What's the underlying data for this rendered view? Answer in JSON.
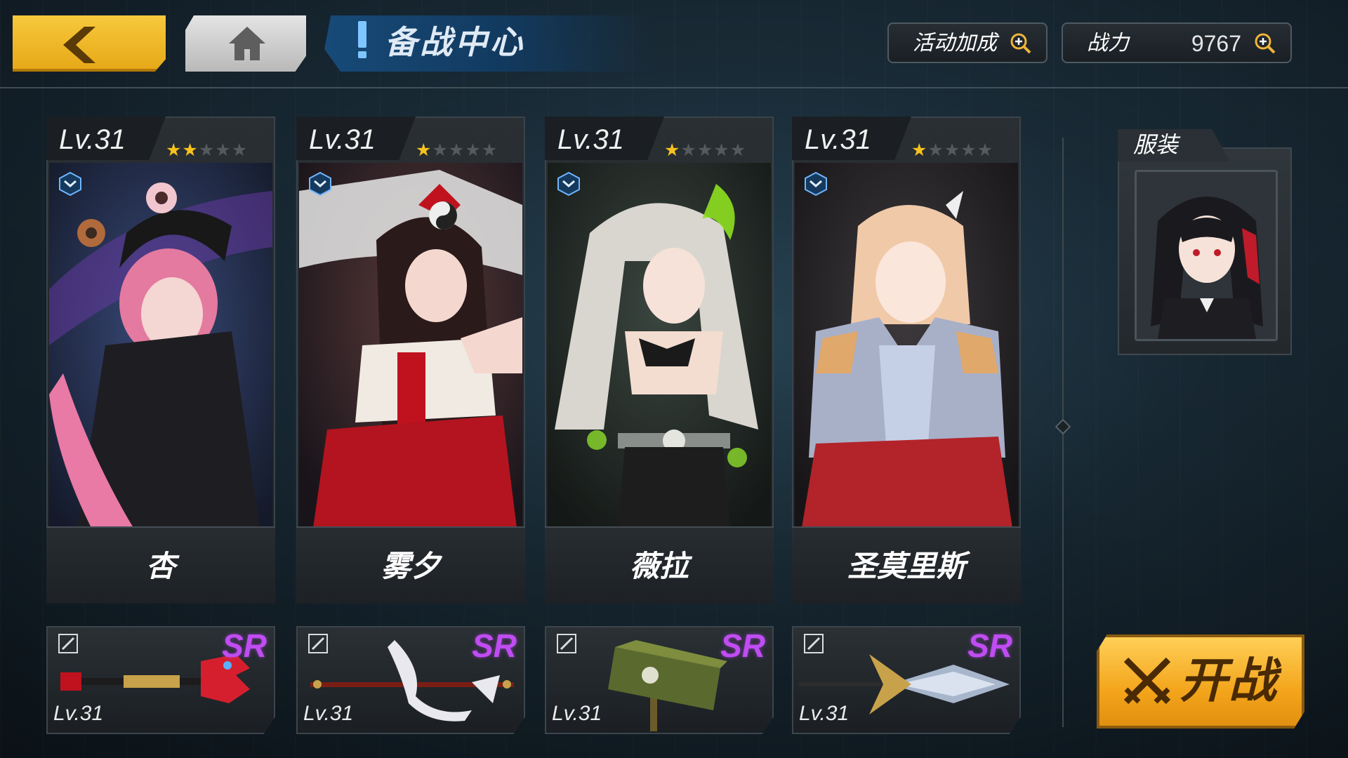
{
  "header": {
    "title": "备战中心",
    "back_icon": "chevron-left-icon",
    "home_icon": "home-icon",
    "bonus_label": "活动加成",
    "power_label": "战力",
    "power_value": "9767"
  },
  "characters": [
    {
      "level": "Lv.31",
      "stars": 2,
      "max_stars": 5,
      "name": "杏",
      "accent": "#e24a7a"
    },
    {
      "level": "Lv.31",
      "stars": 1,
      "max_stars": 5,
      "name": "雾夕",
      "accent": "#c01b2a"
    },
    {
      "level": "Lv.31",
      "stars": 1,
      "max_stars": 5,
      "name": "薇拉",
      "accent": "#8ddc2c"
    },
    {
      "level": "Lv.31",
      "stars": 1,
      "max_stars": 5,
      "name": "圣莫里斯",
      "accent": "#e0a86a"
    }
  ],
  "weapons": [
    {
      "rarity": "SR",
      "level": "Lv.31",
      "icon": "wrench-weapon-icon"
    },
    {
      "rarity": "SR",
      "level": "Lv.31",
      "icon": "staff-weapon-icon"
    },
    {
      "rarity": "SR",
      "level": "Lv.31",
      "icon": "hammer-weapon-icon"
    },
    {
      "rarity": "SR",
      "level": "Lv.31",
      "icon": "spear-weapon-icon"
    }
  ],
  "costume": {
    "label": "服装"
  },
  "start_button": {
    "label": "开战"
  },
  "colors": {
    "gold": "#f6c21c",
    "sr_purple": "#c04cf2",
    "title_blue": "#174a78"
  }
}
